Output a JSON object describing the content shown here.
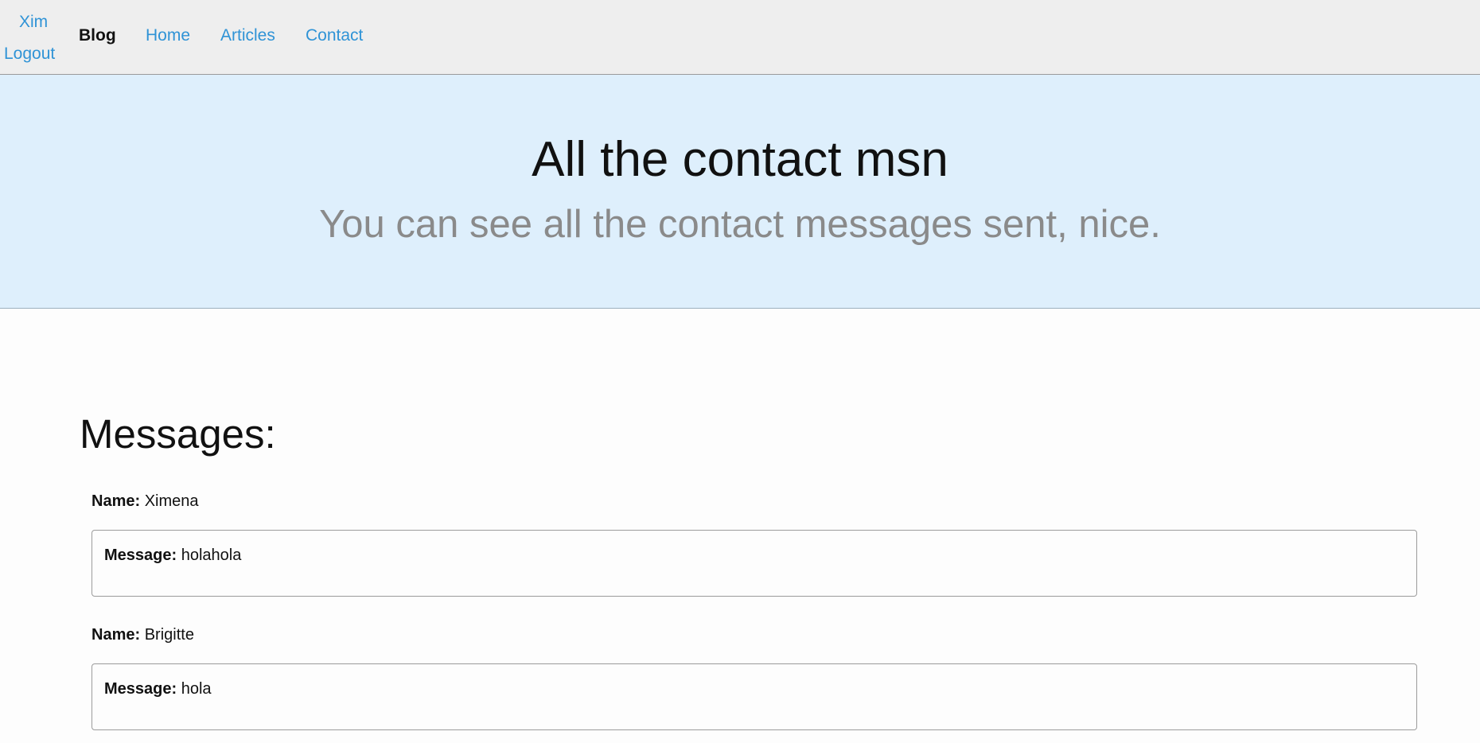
{
  "nav": {
    "user": "Xim",
    "logout": "Logout",
    "brand": "Blog",
    "links": [
      "Home",
      "Articles",
      "Contact"
    ]
  },
  "hero": {
    "title": "All the contact msn",
    "subtitle": "You can see all the contact messages sent, nice."
  },
  "messages_section": {
    "title": "Messages:",
    "name_label": "Name:",
    "message_label": "Message:",
    "items": [
      {
        "name": "Ximena",
        "message": "holahola"
      },
      {
        "name": "Brigitte",
        "message": "hola"
      }
    ]
  },
  "colors": {
    "nav_background": "#eeeeee",
    "hero_background": "#deeffc",
    "link": "#2f93d6",
    "subtitle": "#8a8a8a"
  }
}
